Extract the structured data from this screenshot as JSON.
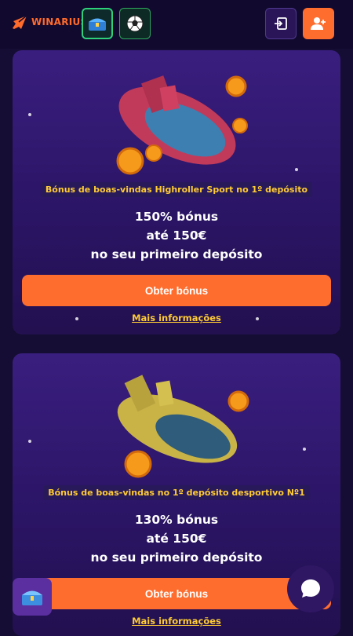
{
  "header": {
    "logo_text": "WINARIUS",
    "icons": {
      "chest": "treasure-chest-icon",
      "ball": "soccer-ball-icon",
      "login": "login-icon",
      "register": "add-user-icon"
    },
    "colors": {
      "accent": "#ff6d2e",
      "highlight": "#2fd17b"
    }
  },
  "cards": [
    {
      "badge": "Bónus de boas-vindas Highroller Sport no 1º depósito",
      "line1": "150% bónus",
      "line2": "até 150€",
      "line3": "no seu primeiro depósito",
      "cta": "Obter bónus",
      "more": "Mais informações"
    },
    {
      "badge": "Bónus de boas-vindas no 1º depósito desportivo Nº1",
      "line1": "130% bónus",
      "line2": "até 150€",
      "line3": "no seu primeiro depósito",
      "cta": "Obter bónus",
      "more": "Mais informações"
    }
  ],
  "floating": {
    "chest_icon": "treasure-chest-icon",
    "chat_icon": "chat-bubble-icon"
  }
}
